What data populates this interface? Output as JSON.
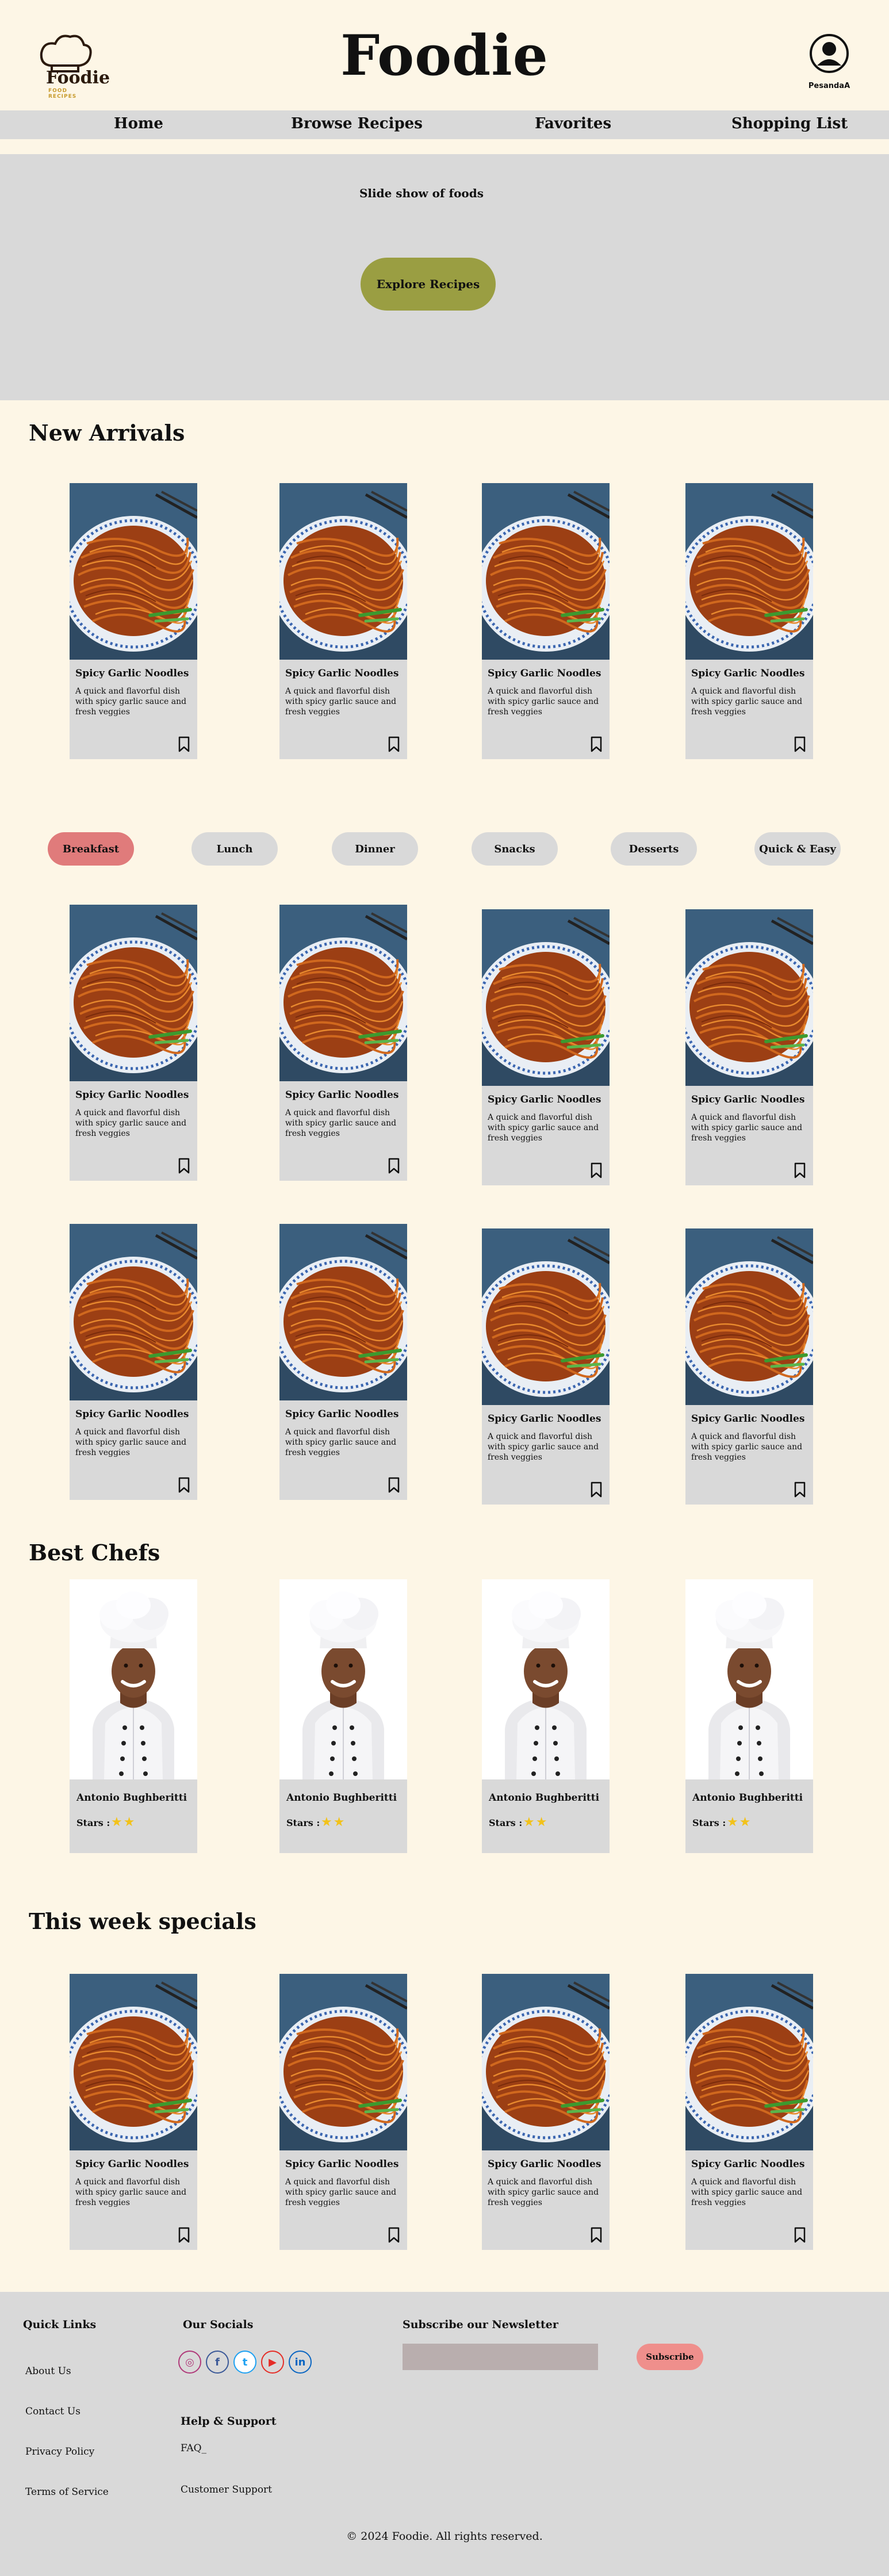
{
  "header": {
    "logo_text": "Foodie",
    "logo_subtext": "FOOD RECIPES",
    "brand": "Foodie",
    "profile_name": "PesandaA"
  },
  "nav": {
    "items": [
      "Home",
      "Browse Recipes",
      "Favorites",
      "Shopping List"
    ]
  },
  "hero": {
    "caption": "Slide show of foods",
    "cta": "Explore Recipes"
  },
  "sections": {
    "new_arrivals": "New Arrivals",
    "best_chefs": "Best Chefs",
    "weekly": "This week specials"
  },
  "recipe": {
    "title": "Spicy Garlic Noodles",
    "desc": "A quick and flavorful dish with spicy garlic sauce and fresh veggies"
  },
  "categories": [
    "Breakfast",
    "Lunch",
    "Dinner",
    "Snacks",
    "Desserts",
    "Quick & Easy"
  ],
  "active_category": "Breakfast",
  "chef": {
    "name": "Antonio Bughberitti",
    "stars_label": "Stars :",
    "stars": "★★",
    "rating": 2
  },
  "footer": {
    "quick_links_title": "Quick Links",
    "quick_links": [
      "About Us",
      "Contact Us",
      "Privacy Policy",
      "Terms of Service"
    ],
    "socials_title": "Our Socials",
    "socials": [
      "instagram-icon",
      "facebook-icon",
      "twitter-icon",
      "youtube-icon",
      "linkedin-icon"
    ],
    "help_title": "Help & Support",
    "help_links": [
      "FAQ_",
      "Customer Support"
    ],
    "newsletter_title": "Subscribe our Newsletter",
    "newsletter_placeholder": "",
    "subscribe": "Subscribe",
    "copyright": "© 2024 Foodie. All rights reserved."
  },
  "colors": {
    "background": "#fdf6e6",
    "panel": "#d9d9d9",
    "accent_green": "#9a9e42",
    "active_pill": "#e07b7b",
    "subscribe": "#ef8f8c",
    "star": "#f2c21a"
  }
}
